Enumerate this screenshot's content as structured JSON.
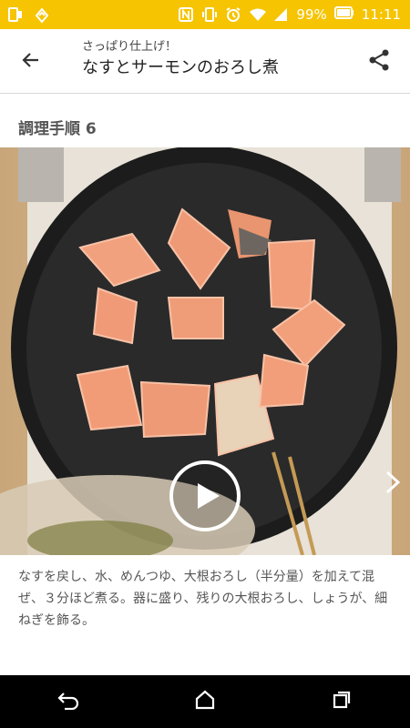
{
  "status_bar": {
    "battery": "99%",
    "time": "11:11",
    "left_icons": [
      "phone-icon",
      "app-notification-icon"
    ],
    "right_icons": [
      "nfc-icon",
      "vibrate-icon",
      "alarm-icon",
      "wifi-icon",
      "signal-icon",
      "battery-icon"
    ],
    "background": "#f6c400"
  },
  "header": {
    "subtitle": "さっぱり仕上げ！",
    "title": "なすとサーモンのおろし煮",
    "back_icon": "arrow-back-icon",
    "share_icon": "share-icon"
  },
  "step": {
    "heading": "調理手順 6",
    "description": "なすを戻し、水、めんつゆ、大根おろし（半分量）を加えて混ぜ、３分ほど煮る。器に盛り、残りの大根おろし、しょうが、細ねぎを飾る。"
  },
  "video": {
    "play_icon": "play-icon",
    "next_icon": "chevron-right-icon"
  },
  "nav_bar": {
    "icons": [
      "back-nav-icon",
      "home-nav-icon",
      "recents-nav-icon"
    ]
  }
}
